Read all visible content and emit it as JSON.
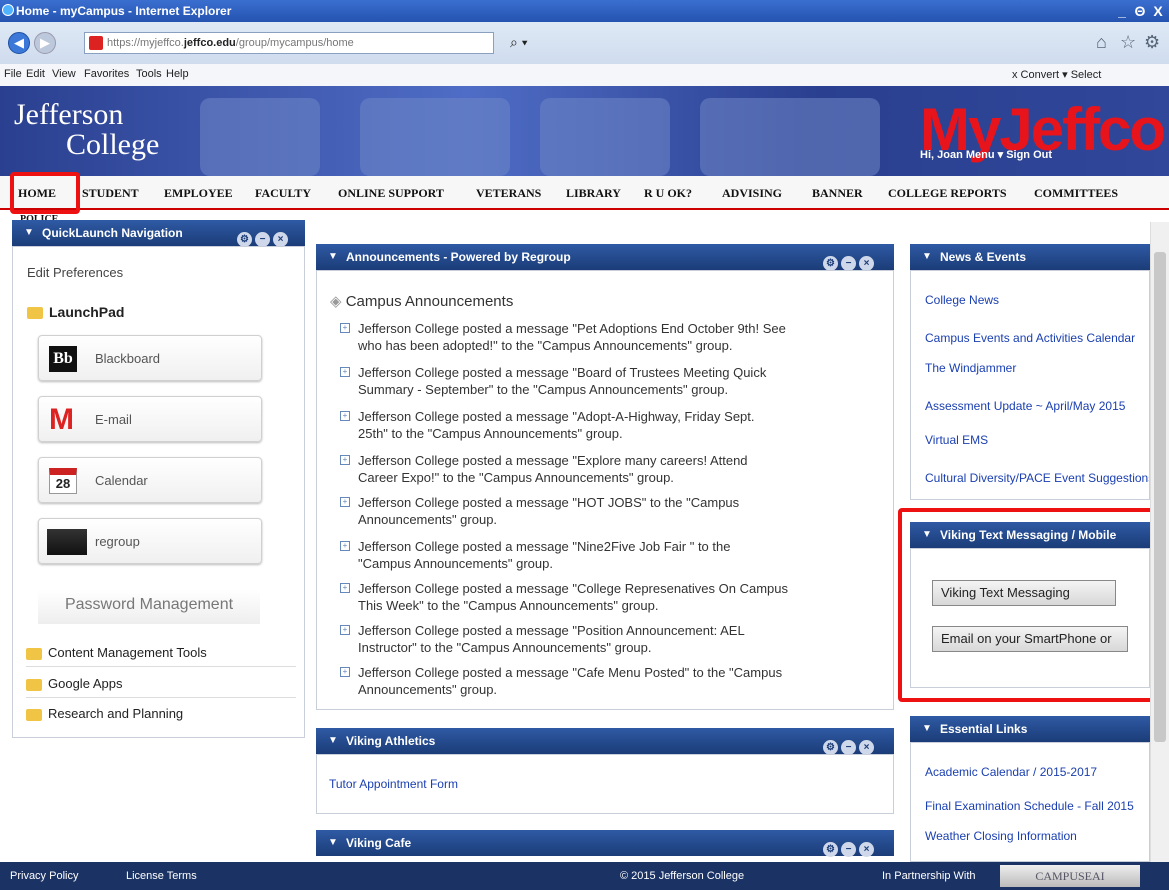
{
  "window": {
    "title": "Home - myCampus - Internet Explorer",
    "controls": [
      "_",
      "Θ",
      "X"
    ]
  },
  "browser": {
    "url_prefix": "https://myjeffco.",
    "url_host": "jeffco.edu",
    "url_path": "/group/mycampus/home",
    "search": "⌕ ▾",
    "menu": [
      "File",
      "Edit",
      "View",
      "Favorites",
      "Tools",
      "Help"
    ],
    "right": "x    Convert ▾   Select"
  },
  "banner": {
    "logo1": "Jefferson",
    "logo2": "College",
    "brand": "MyJeffco",
    "user": "Hi, Joan   Menu ▾   Sign Out"
  },
  "nav": [
    "HOME",
    "STUDENT",
    "EMPLOYEE",
    "FACULTY",
    "ONLINE SUPPORT",
    "VETERANS",
    "LIBRARY",
    "R U OK?",
    "ADVISING",
    "BANNER",
    "COLLEGE REPORTS",
    "COMMITTEES",
    "POLICE"
  ],
  "quicklaunch": {
    "title": "QuickLaunch Navigation",
    "edit": "Edit Preferences",
    "launchpad": "LaunchPad",
    "apps": [
      "Blackboard",
      "E-mail",
      "Calendar",
      "regroup"
    ],
    "cal_day": "28",
    "pw": "Password Management",
    "folders": [
      "Content Management Tools",
      "Google Apps",
      "Research and Planning"
    ]
  },
  "announcements": {
    "title": "Announcements - Powered by Regroup",
    "heading": "Campus Announcements",
    "items": [
      [
        "Jefferson College posted a message \"Pet Adoptions End October 9th! See",
        "who has been adopted!\" to the \"Campus Announcements\" group."
      ],
      [
        "Jefferson College posted a message \"Board of Trustees Meeting Quick",
        "Summary - September\" to the \"Campus Announcements\" group."
      ],
      [
        "Jefferson College posted a message \"Adopt-A-Highway, Friday Sept.",
        "25th\" to the \"Campus Announcements\" group."
      ],
      [
        "Jefferson College posted a message \"Explore many careers! Attend",
        "Career Expo!\" to the \"Campus Announcements\" group."
      ],
      [
        "Jefferson College posted a message \"HOT JOBS\" to the \"Campus",
        "Announcements\" group."
      ],
      [
        "Jefferson College posted a message \"Nine2Five Job Fair \" to the",
        "\"Campus Announcements\" group."
      ],
      [
        "Jefferson College posted a message \"College Represenatives On Campus",
        "This Week\" to the \"Campus Announcements\" group."
      ],
      [
        "Jefferson College posted a message \"Position Announcement: AEL",
        "Instructor\" to the \"Campus Announcements\" group."
      ],
      [
        "Jefferson College posted a message \"Cafe Menu Posted\" to the \"Campus",
        "Announcements\" group."
      ]
    ]
  },
  "athletics": {
    "title": "Viking Athletics",
    "link": "Tutor Appointment Form"
  },
  "cafe": {
    "title": "Viking Cafe"
  },
  "news": {
    "title": "News & Events",
    "links": [
      "College News",
      "Campus Events and Activities Calendar",
      "The Windjammer",
      "Assessment Update ~ April/May 2015",
      "Virtual EMS",
      "Cultural Diversity/PACE Event Suggestions"
    ]
  },
  "viking_text": {
    "title": "Viking Text Messaging / Mobile",
    "btn1": "Viking Text Messaging",
    "btn2": "Email on your SmartPhone or"
  },
  "essential": {
    "title": "Essential Links",
    "links": [
      "Academic Calendar / 2015-2017",
      "Final Examination Schedule - Fall 2015",
      "Weather Closing Information"
    ]
  },
  "footer": {
    "privacy": "Privacy Policy",
    "license": "License Terms",
    "copy": "© 2015 Jefferson College",
    "partner": "In Partnership With",
    "campuseai": "CAMPUSEAI"
  },
  "colors": {
    "accent": "#1b3c78",
    "highlight": "#e11111"
  }
}
